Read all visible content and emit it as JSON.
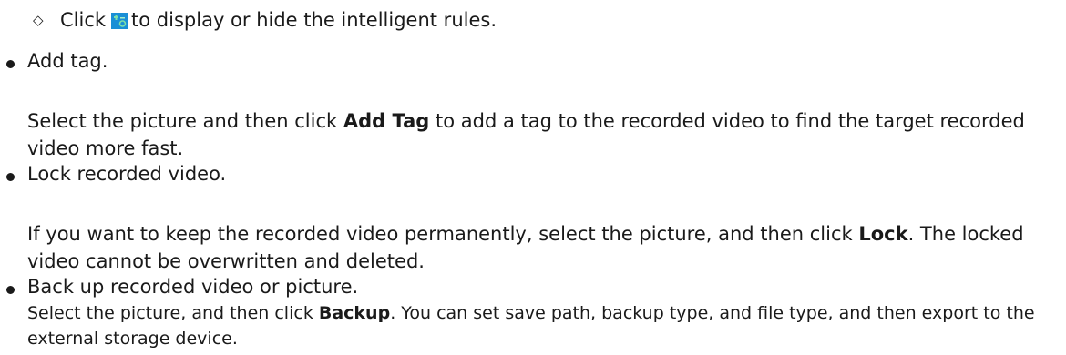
{
  "sub_bullet": {
    "marker": "◇",
    "text_before": "Click",
    "icon": "intelligent-rules-icon",
    "text_after": "to display or hide the intelligent rules."
  },
  "items": [
    {
      "heading": "Add tag.",
      "para_before": "Select the picture and then click ",
      "para_bold": "Add Tag",
      "para_after": " to add a tag to the recorded video to find the target recorded video more fast."
    },
    {
      "heading": "Lock recorded video.",
      "para_before": "If you want to keep the recorded video permanently, select the picture, and then click ",
      "para_bold": "Lock",
      "para_after": ". The locked video cannot be overwritten and deleted."
    },
    {
      "heading": "Back up recorded video or picture.",
      "para_before": "Select the picture, and then click ",
      "para_bold": "Backup",
      "para_after": ". You can set save path, backup type, and file type, and then export to the external storage device."
    }
  ],
  "colors": {
    "icon_bg": "#1a8fd6",
    "icon_fg": "#7fe0a8"
  }
}
